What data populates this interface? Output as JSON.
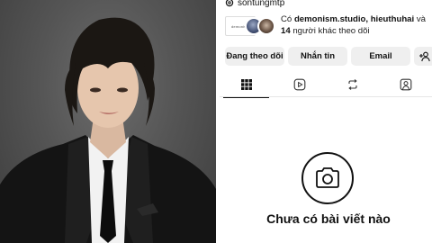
{
  "profile": {
    "handle": "sontungmtp",
    "followed_by": {
      "prefix": "Có ",
      "names": "demonism.studio, hieuthuhai",
      "middle": " và ",
      "count": "14",
      "suffix": " người khác theo dõi",
      "avatar_label": "demonism"
    },
    "buttons": {
      "following": "Đang theo dõi",
      "message": "Nhắn tin",
      "email": "Email"
    },
    "tabs": [
      "grid-icon",
      "reels-icon",
      "reposts-icon",
      "tagged-icon"
    ],
    "empty_state": {
      "title": "Chưa có bài viết nào",
      "icon": "camera-icon"
    }
  },
  "colors": {
    "button_bg": "#efefef",
    "photo_bg": "#555555",
    "text": "#111111"
  }
}
